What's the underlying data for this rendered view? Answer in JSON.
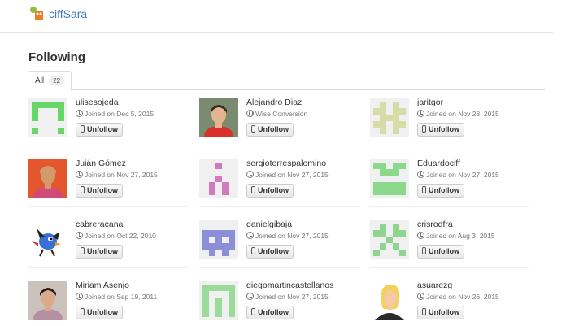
{
  "header": {
    "brand": "ciffSara"
  },
  "page": {
    "title": "Following"
  },
  "tabs": [
    {
      "label": "All",
      "count": "22"
    }
  ],
  "action_label": "Unfollow",
  "users": [
    {
      "username": "ulisesojeda",
      "meta": "Joined on Dec 5, 2015",
      "meta_icon": "clock-icon",
      "avatar": {
        "type": "identicon",
        "color": "#67d567",
        "pattern": [
          "11111",
          "10001",
          "10001",
          "00000",
          "10001"
        ]
      }
    },
    {
      "username": "Alejandro Diaz",
      "meta": "Wise Conversion",
      "meta_icon": "globe-icon",
      "avatar": {
        "type": "photo",
        "bg": "#7a8b6f",
        "skin": "#e2b48f",
        "shirt": "#d9302a",
        "hair": "#3a2a1e"
      }
    },
    {
      "username": "jaritgor",
      "meta": "Joined on Nov 28, 2015",
      "meta_icon": "clock-icon",
      "avatar": {
        "type": "identicon",
        "color": "#d5dca8",
        "pattern": [
          "01010",
          "11011",
          "01110",
          "11011",
          "01010"
        ]
      }
    },
    {
      "username": "Juián Gómez",
      "meta": "Joined on Nov 27, 2015",
      "meta_icon": "clock-icon",
      "avatar": {
        "type": "photo",
        "bg": "#e4572e",
        "skin": "#d39a6a",
        "shirt": "#d04a7a",
        "hair": "#d39a6a"
      }
    },
    {
      "username": "sergiotorrespalomino",
      "meta": "Joined on Nov 27, 2015",
      "meta_icon": "clock-icon",
      "avatar": {
        "type": "identicon",
        "color": "#d07ac0",
        "pattern": [
          "00100",
          "00000",
          "00100",
          "01010",
          "01010"
        ]
      }
    },
    {
      "username": "Eduardociff",
      "meta": "Joined on Nov 27, 2015",
      "meta_icon": "clock-icon",
      "avatar": {
        "type": "identicon",
        "color": "#8cd98c",
        "pattern": [
          "11011",
          "01110",
          "00000",
          "11111",
          "11111"
        ]
      }
    },
    {
      "username": "cabreracanal",
      "meta": "Joined on Oct 22, 2010",
      "meta_icon": "clock-icon",
      "avatar": {
        "type": "bird",
        "bg": "#ffffff",
        "body": "#3a6fd8"
      }
    },
    {
      "username": "danielgibaja",
      "meta": "Joined on Nov 27, 2015",
      "meta_icon": "clock-icon",
      "avatar": {
        "type": "identicon",
        "color": "#8d8ed8",
        "pattern": [
          "00000",
          "11111",
          "10101",
          "11111",
          "01010"
        ]
      }
    },
    {
      "username": "crisrodfra",
      "meta": "Joined on Aug 3, 2015",
      "meta_icon": "clock-icon",
      "avatar": {
        "type": "identicon",
        "color": "#8fd48f",
        "pattern": [
          "01010",
          "11011",
          "00100",
          "01010",
          "10001"
        ]
      }
    },
    {
      "username": "Miriam Asenjo",
      "meta": "Joined on Sep 19, 2011",
      "meta_icon": "clock-icon",
      "avatar": {
        "type": "photo",
        "bg": "#c9c2bd",
        "skin": "#d9a98a",
        "shirt": "#b58ea0",
        "hair": "#2b1c15"
      }
    },
    {
      "username": "diegomartincastellanos",
      "meta": "Joined on Nov 27, 2015",
      "meta_icon": "clock-icon",
      "avatar": {
        "type": "identicon",
        "color": "#9adb9a",
        "pattern": [
          "11111",
          "10001",
          "10101",
          "10101",
          "10101"
        ]
      }
    },
    {
      "username": "asuarezg",
      "meta": "Joined on Nov 26, 2015",
      "meta_icon": "clock-icon",
      "avatar": {
        "type": "cartoon",
        "bg": "#ffffff",
        "hair": "#f2d15b",
        "skin": "#f4c9a4",
        "shirt": "#2a2a2a"
      }
    }
  ]
}
